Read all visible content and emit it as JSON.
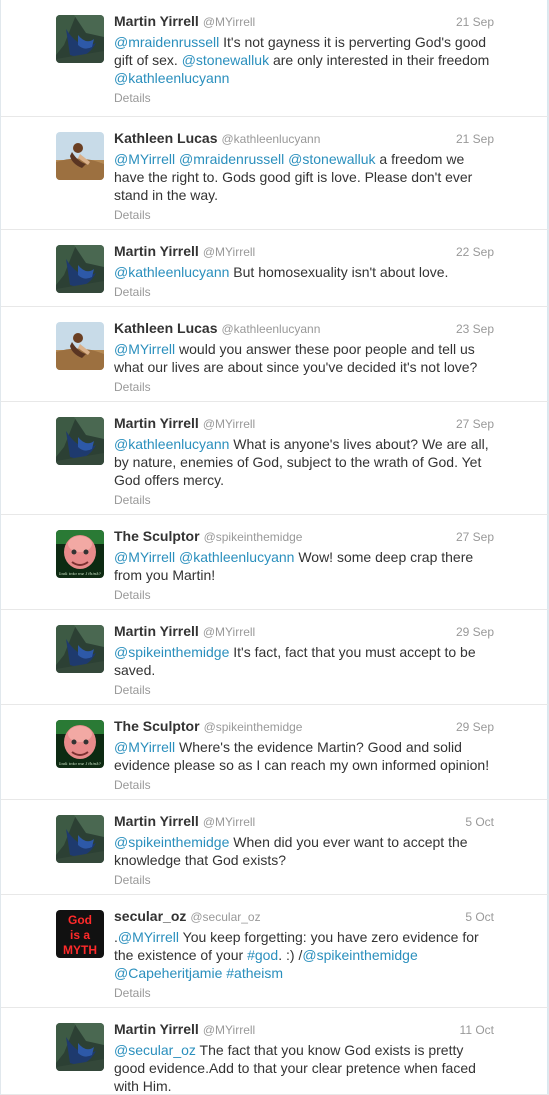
{
  "tweets": [
    {
      "name": "Martin Yirrell",
      "handle": "@MYirrell",
      "time": "21 Sep",
      "avatar": "martin",
      "parts": [
        [
          "@mraidenrussell",
          "link"
        ],
        [
          " It's not gayness it is perverting God's good gift of sex. ",
          "text"
        ],
        [
          "@stonewalluk",
          "link"
        ],
        [
          " are only interested in their freedom ",
          "text"
        ],
        [
          "@kathleenlucyann",
          "link"
        ]
      ],
      "details": "Details"
    },
    {
      "name": "Kathleen Lucas",
      "handle": "@kathleenlucyann",
      "time": "21 Sep",
      "avatar": "kathleen",
      "parts": [
        [
          "@MYirrell",
          "link"
        ],
        [
          " ",
          "text"
        ],
        [
          "@mraidenrussell",
          "link"
        ],
        [
          " ",
          "text"
        ],
        [
          "@stonewalluk",
          "link"
        ],
        [
          " a freedom we have the right to. Gods good gift is love. Please don't ever stand in the way.",
          "text"
        ]
      ],
      "details": "Details"
    },
    {
      "name": "Martin Yirrell",
      "handle": "@MYirrell",
      "time": "22 Sep",
      "avatar": "martin",
      "parts": [
        [
          "@kathleenlucyann",
          "link"
        ],
        [
          " But homosexuality isn't about love.",
          "text"
        ]
      ],
      "details": "Details"
    },
    {
      "name": "Kathleen Lucas",
      "handle": "@kathleenlucyann",
      "time": "23 Sep",
      "avatar": "kathleen",
      "parts": [
        [
          "@MYirrell",
          "link"
        ],
        [
          " would you answer these poor people and tell us what our lives are about since you've decided it's not love?",
          "text"
        ]
      ],
      "details": "Details"
    },
    {
      "name": "Martin Yirrell",
      "handle": "@MYirrell",
      "time": "27 Sep",
      "avatar": "martin",
      "parts": [
        [
          "@kathleenlucyann",
          "link"
        ],
        [
          " What is anyone's lives about? We are all, by nature, enemies of God, subject to the wrath of God. Yet God offers mercy.",
          "text"
        ]
      ],
      "details": "Details"
    },
    {
      "name": "The Sculptor",
      "handle": "@spikeinthemidge",
      "time": "27 Sep",
      "avatar": "sculptor",
      "parts": [
        [
          "@MYirrell",
          "link"
        ],
        [
          " ",
          "text"
        ],
        [
          "@kathleenlucyann",
          "link"
        ],
        [
          " Wow! some deep crap there from you Martin!",
          "text"
        ]
      ],
      "details": "Details"
    },
    {
      "name": "Martin Yirrell",
      "handle": "@MYirrell",
      "time": "29 Sep",
      "avatar": "martin",
      "parts": [
        [
          "@spikeinthemidge",
          "link"
        ],
        [
          " It's fact, fact that you must accept to be saved.",
          "text"
        ]
      ],
      "details": "Details"
    },
    {
      "name": "The Sculptor",
      "handle": "@spikeinthemidge",
      "time": "29 Sep",
      "avatar": "sculptor",
      "parts": [
        [
          "@MYirrell",
          "link"
        ],
        [
          " Where's the evidence Martin? Good and solid evidence please so as I can reach my own informed opinion!",
          "text"
        ]
      ],
      "details": "Details"
    },
    {
      "name": "Martin Yirrell",
      "handle": "@MYirrell",
      "time": "5 Oct",
      "avatar": "martin",
      "parts": [
        [
          "@spikeinthemidge",
          "link"
        ],
        [
          " When did you ever want to accept the knowledge that God exists?",
          "text"
        ]
      ],
      "details": "Details"
    },
    {
      "name": "secular_oz",
      "handle": "@secular_oz",
      "time": "5 Oct",
      "avatar": "myth",
      "parts": [
        [
          ".",
          "text"
        ],
        [
          "@MYirrell",
          "link"
        ],
        [
          " You keep forgetting: you have zero evidence for the existence of your ",
          "text"
        ],
        [
          "#god",
          "link"
        ],
        [
          ". :) /",
          "text"
        ],
        [
          "@spikeinthemidge",
          "link"
        ],
        [
          " ",
          "text"
        ],
        [
          "@Capeheritjamie",
          "link"
        ],
        [
          " ",
          "text"
        ],
        [
          "#atheism",
          "link"
        ]
      ],
      "details": "Details"
    },
    {
      "name": "Martin Yirrell",
      "handle": "@MYirrell",
      "time": "11 Oct",
      "avatar": "martin",
      "parts": [
        [
          "@secular_oz",
          "link"
        ],
        [
          " The fact that you know God exists is pretty good evidence.Add to that your clear pretence when faced with Him.",
          "text"
        ]
      ],
      "details": ""
    }
  ],
  "avatar_texts": {
    "myth": [
      "God",
      "is a",
      "MYTH"
    ],
    "sculptor": "look into me I think?"
  },
  "colors": {
    "link": "#2a8fbd",
    "name": "#333333",
    "meta": "#999999"
  }
}
